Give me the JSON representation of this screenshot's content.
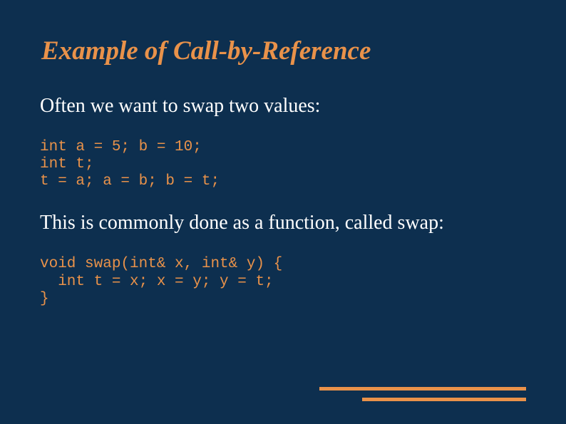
{
  "title": "Example of Call-by-Reference",
  "paragraph1": "Often we want to swap two values:",
  "code1": "int a = 5; b = 10;\nint t;\nt = a; a = b; b = t;",
  "paragraph2": "This is commonly done as a function, called swap:",
  "code2": "void swap(int& x, int& y) {\n  int t = x; x = y; y = t;\n}"
}
